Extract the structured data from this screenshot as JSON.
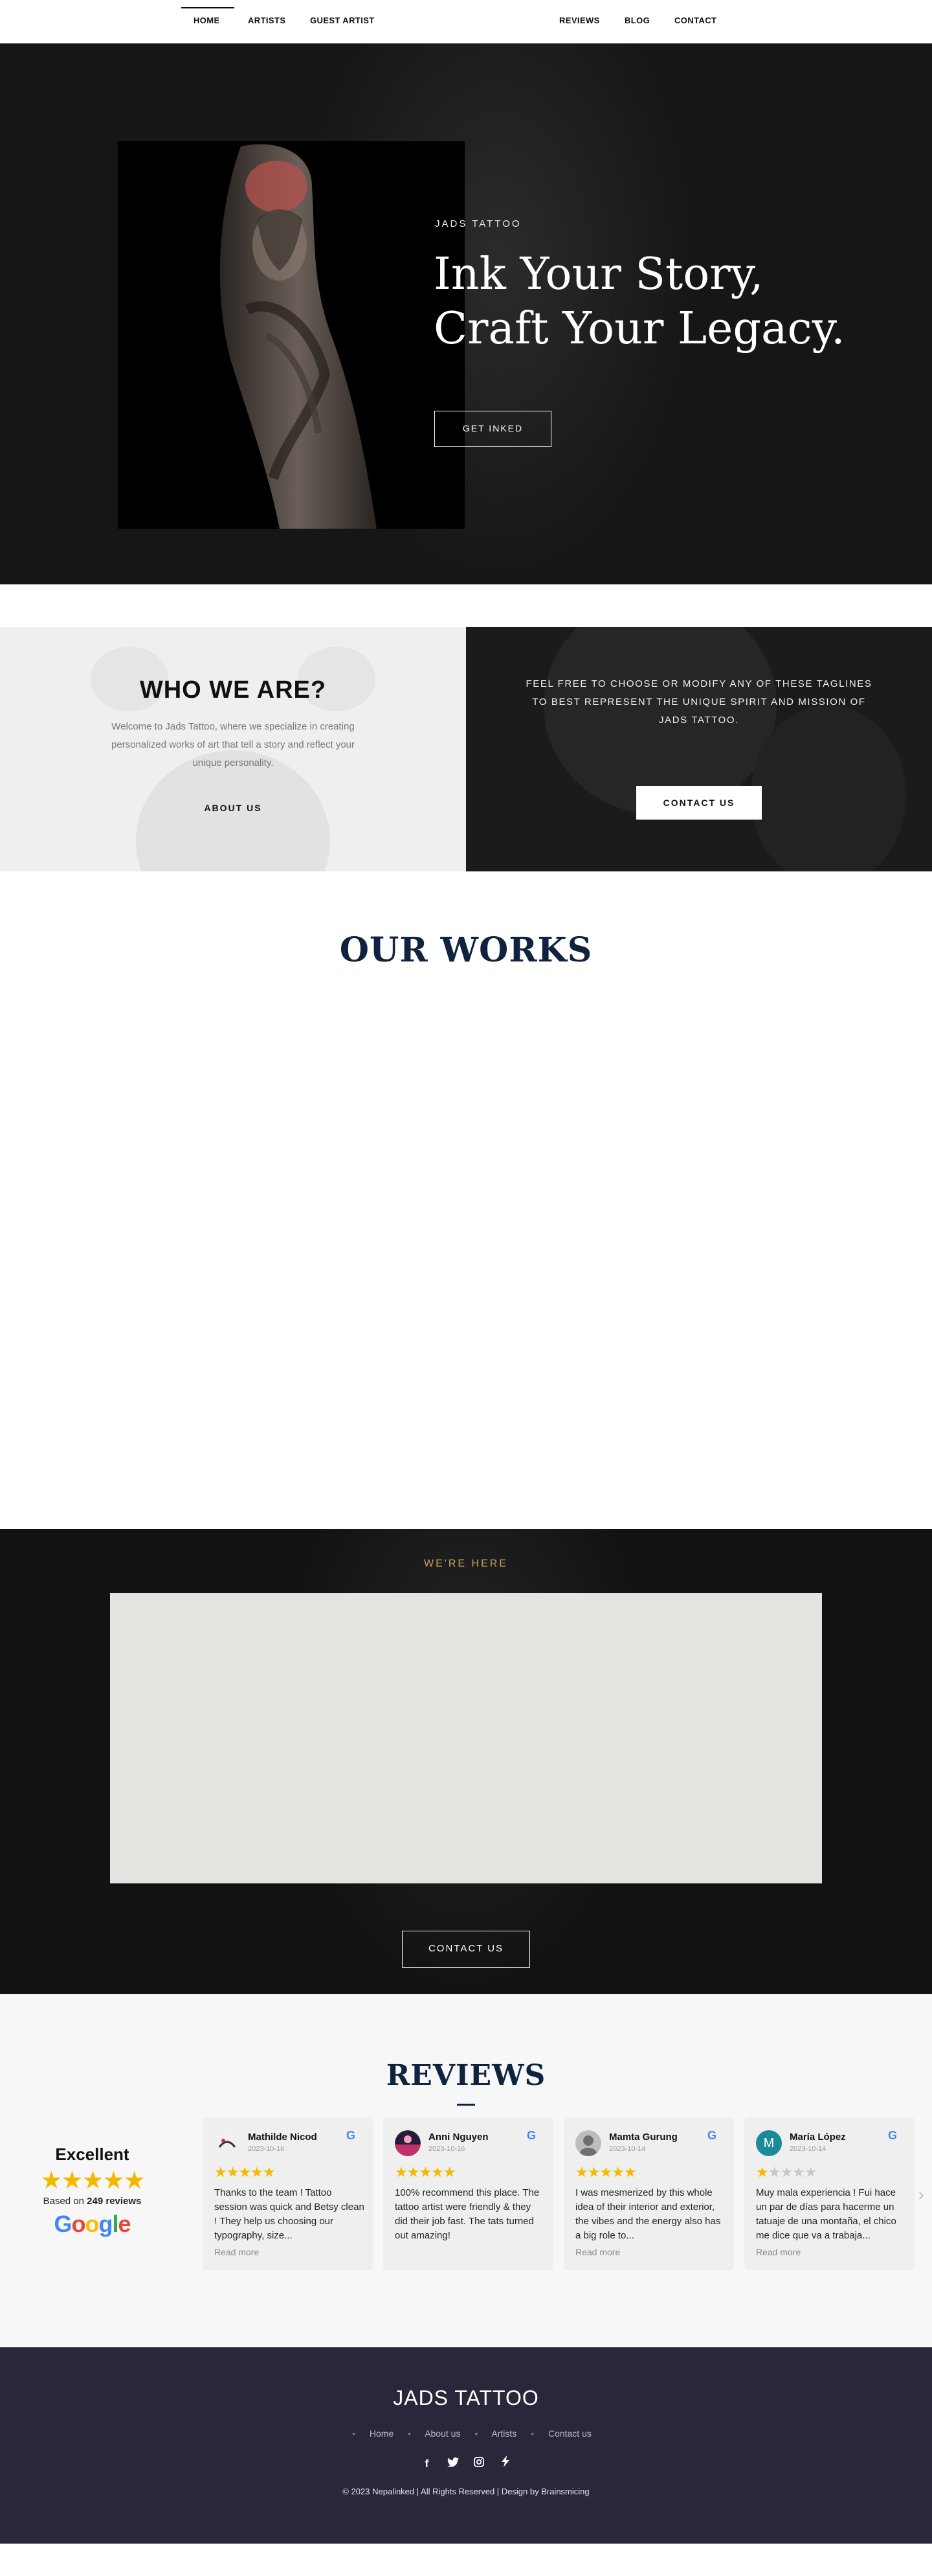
{
  "nav": {
    "items_left": [
      "HOME",
      "ARTISTS",
      "GUEST ARTIST"
    ],
    "items_right": [
      "REVIEWS",
      "BLOG",
      "CONTACT"
    ],
    "active": "HOME"
  },
  "hero": {
    "kicker": "JADS TATTOO",
    "title_line1": "Ink Your Story,",
    "title_line2": "Craft Your Legacy.",
    "cta": "GET INKED"
  },
  "about": {
    "title": "WHO WE ARE?",
    "text": "Welcome to Jads Tattoo, where we specialize in creating personalized works of art that tell a story and reflect your unique personality.",
    "link": "ABOUT US",
    "tagline": "FEEL FREE TO CHOOSE OR MODIFY ANY OF THESE TAGLINES TO BEST REPRESENT THE UNIQUE SPIRIT AND MISSION OF JADS TATTOO.",
    "contact_button": "CONTACT US"
  },
  "works": {
    "title": "OUR WORKS"
  },
  "location": {
    "kicker": "WE'RE HERE",
    "contact_button": "CONTACT US"
  },
  "reviews": {
    "title": "REVIEWS",
    "summary": {
      "label": "Excellent",
      "rating": 5,
      "based_on_prefix": "Based on",
      "count_text": "249 reviews",
      "brand": "Google"
    },
    "items": [
      {
        "name": "Mathilde Nicod",
        "date": "2023-10-16",
        "stars": 5,
        "text": "Thanks to the team ! Tattoo session was quick and Betsy clean ! They help us choosing our typography, size...",
        "more": "Read more"
      },
      {
        "name": "Anni Nguyen",
        "date": "2023-10-16",
        "stars": 5,
        "text": "100% recommend this place. The tattoo artist were friendly & they did their job fast. The tats turned out amazing!",
        "more": ""
      },
      {
        "name": "Mamta Gurung",
        "date": "2023-10-14",
        "stars": 5,
        "text": "I was mesmerized by this whole idea of their interior and exterior, the vibes and the energy also has a big role to...",
        "more": "Read more"
      },
      {
        "name": "María López",
        "date": "2023-10-14",
        "stars": 1,
        "text": "Muy mala experiencia ! Fui hace un par de días para hacerme un tatuaje de una montaña, el chico me dice que va a trabaja...",
        "more": "Read more",
        "initial": "M"
      }
    ]
  },
  "footer": {
    "brand": "JADS TATTOO",
    "links": [
      "Home",
      "About us",
      "Artists",
      "Contact us"
    ],
    "socials": [
      "facebook-icon",
      "twitter-icon",
      "instagram-icon",
      "zap-icon"
    ],
    "copyright": "© 2023 Nepalinked | All Rights Reserved | Design by Brainsmicing"
  },
  "colors": {
    "hero_bg": "#161616",
    "navy": "#0f2340",
    "gold": "#c9a55a",
    "footer_bg": "#28283a",
    "star": "#f5b800"
  }
}
